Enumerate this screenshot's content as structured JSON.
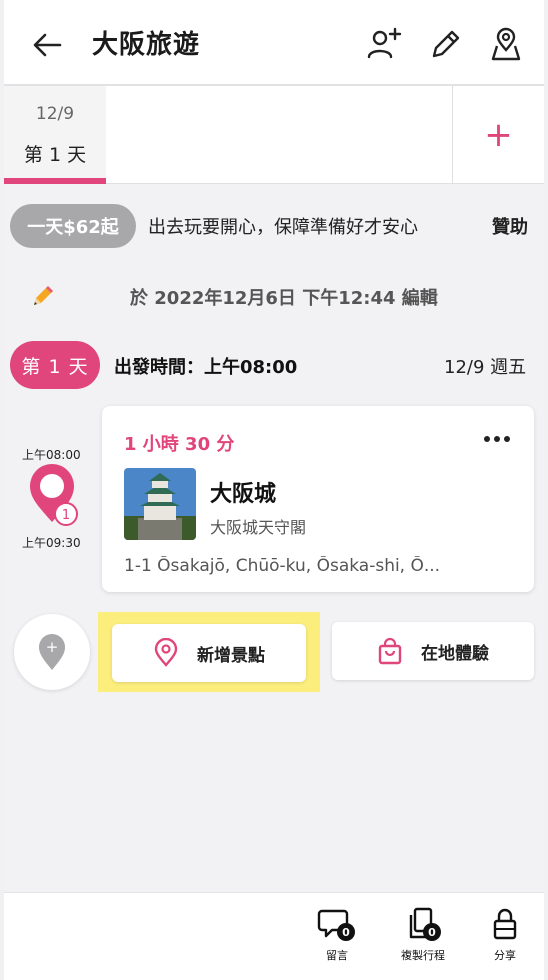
{
  "header": {
    "title": "大阪旅遊",
    "icons": [
      "back-arrow-icon",
      "add-person-icon",
      "pencil-icon",
      "map-pin-icon"
    ]
  },
  "tabs": {
    "days": [
      {
        "date": "12/9",
        "label": "第 1 天"
      }
    ],
    "add_label": "+"
  },
  "promo": {
    "badge": "一天$62起",
    "text": "出去玩要開心，保障準備好才安心",
    "sponsor": "贊助"
  },
  "edit_info": {
    "text": "於 2022年12月6日 下午12:44 編輯"
  },
  "day": {
    "badge": "第 1 天",
    "departure": "出發時間：上午08:00",
    "date": "12/9 週五"
  },
  "timeline": {
    "start_time": "上午08:00",
    "end_time": "上午09:30",
    "stop_number": "1"
  },
  "place": {
    "duration": "1 小時 30 分",
    "name": "大阪城",
    "subtitle": "大阪城天守閣",
    "address": "1-1 Ōsakajō, Chūō-ku, Ōsaka-shi, Ō..."
  },
  "actions": {
    "add_spot": "新增景點",
    "local_experience": "在地體驗",
    "add_pin_symbol": "+"
  },
  "bottom_bar": {
    "comments_label": "留言",
    "comments_count": "0",
    "copy_label": "複製行程",
    "copy_count": "0",
    "share_label": "分享"
  },
  "colors": {
    "accent": "#e0457b",
    "highlight": "#fbee7d",
    "badge_gray": "#a8a8ab"
  }
}
